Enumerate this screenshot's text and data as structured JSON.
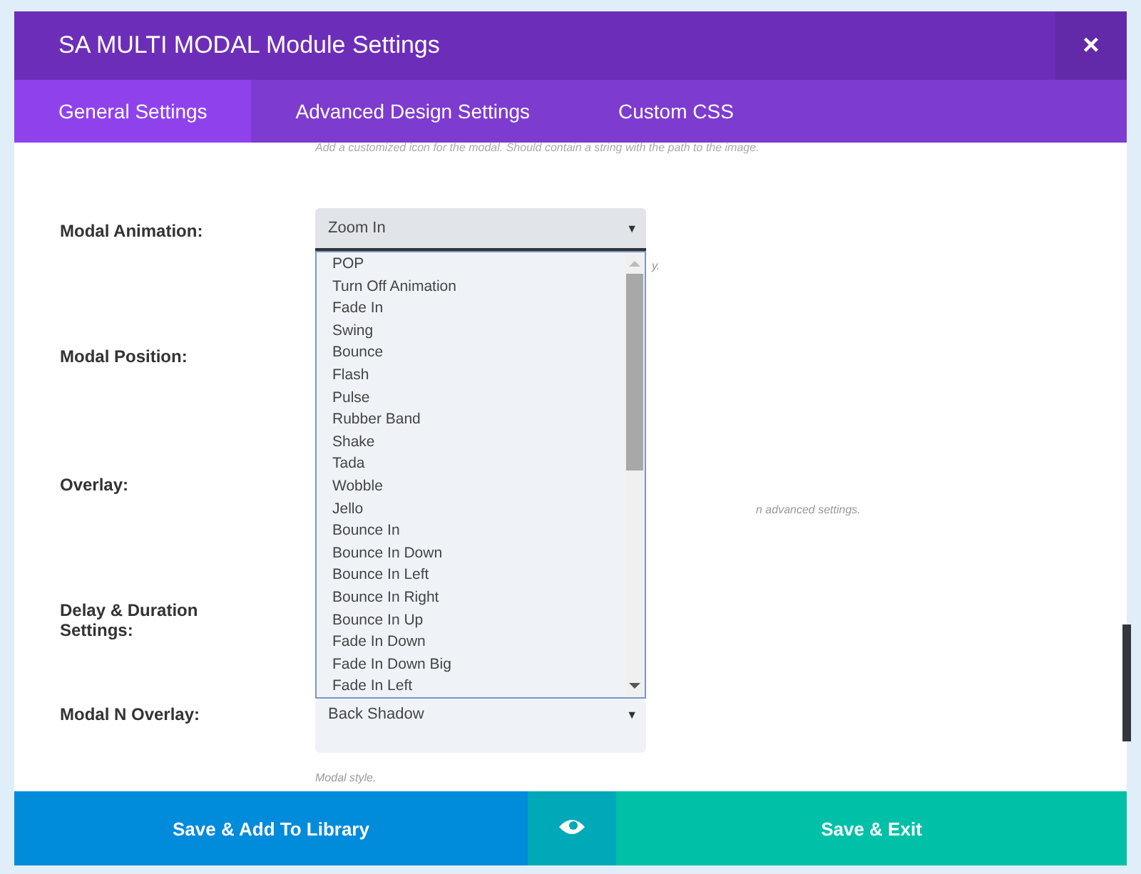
{
  "window": {
    "title": "SA MULTI MODAL Module Settings",
    "close": "×"
  },
  "tabs": [
    {
      "label": "General Settings",
      "selected": true
    },
    {
      "label": "Advanced Design Settings",
      "selected": false
    },
    {
      "label": "Custom CSS",
      "selected": false
    }
  ],
  "top_hint": "Add a customized icon for the modal. Should contain a string with the path to the image.",
  "fields": [
    {
      "label": "Modal Animation:",
      "kind": "select",
      "value": "Zoom In",
      "caret": "▼",
      "hint": "y.",
      "expanded": true
    },
    {
      "label": "Modal Position:",
      "kind": "empty"
    },
    {
      "label": "Overlay:",
      "kind": "empty",
      "hint": "n advanced settings."
    },
    {
      "label": "Delay & Duration Settings:",
      "kind": "empty"
    },
    {
      "label": "Modal N Overlay:",
      "kind": "select",
      "value": "Back Shadow",
      "caret": "▼",
      "hint": "Modal style.",
      "expanded": false
    }
  ],
  "dropdown": {
    "options": [
      "POP",
      "Turn Off Animation",
      "Fade In",
      "Swing",
      "Bounce",
      "Flash",
      "Pulse",
      "Rubber Band",
      "Shake",
      "Tada",
      "Wobble",
      "Jello",
      "Bounce In",
      "Bounce In Down",
      "Bounce In Left",
      "Bounce In Right",
      "Bounce In Up",
      "Fade In Down",
      "Fade In Down Big",
      "Fade In Left"
    ]
  },
  "footer": {
    "library_button": "Save & Add To Library",
    "exit_button": "Save & Exit"
  }
}
